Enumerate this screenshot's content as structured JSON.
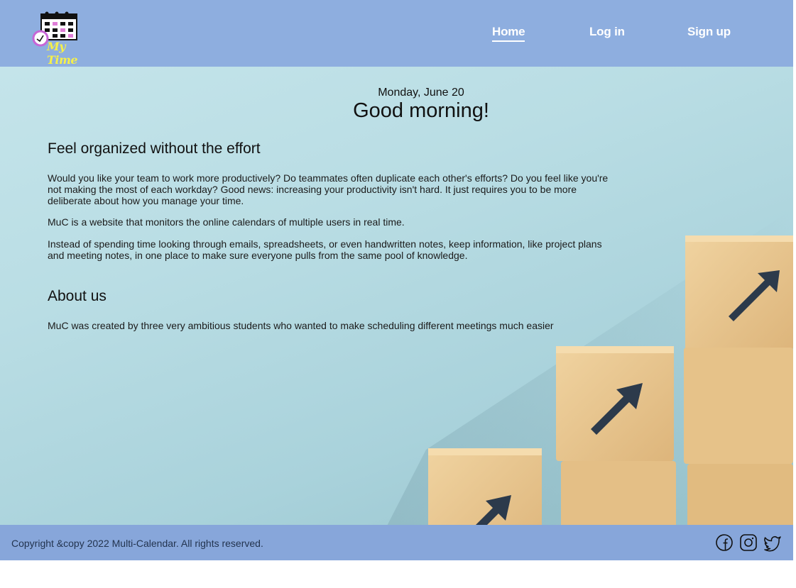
{
  "brand": {
    "logo_text": "My Time"
  },
  "nav": {
    "home": "Home",
    "login": "Log in",
    "signup": "Sign up"
  },
  "greeting": {
    "date": "Monday, June 20",
    "message": "Good morning!"
  },
  "features": {
    "title": "Feel organized without the effort",
    "p1": "Would you like your team to work more productively? Do teammates often duplicate each other's efforts? Do you feel like you're not making the most of each workday? Good news: increasing your productivity isn't hard. It just requires you to be more deliberate about how you manage your time.",
    "p2": "MuC is a website that monitors the online calendars of multiple users in real time.",
    "p3": "Instead of spending time looking through emails, spreadsheets, or even handwritten notes, keep information, like project plans and meeting notes, in one place to make sure everyone pulls from the same pool of knowledge."
  },
  "about": {
    "title": "About us",
    "p1": "MuC was created by three very ambitious students who wanted to make scheduling different meetings much easier"
  },
  "footer": {
    "copyright": "Copyright &copy 2022 Multi-Calendar. All rights reserved.",
    "icons": [
      "facebook-icon",
      "instagram-icon",
      "twitter-icon"
    ]
  },
  "colors": {
    "nav": "#8eaedf",
    "logo_text": "#f5f04a",
    "block": "#e8c58f",
    "arrow": "#2c3a4b"
  }
}
